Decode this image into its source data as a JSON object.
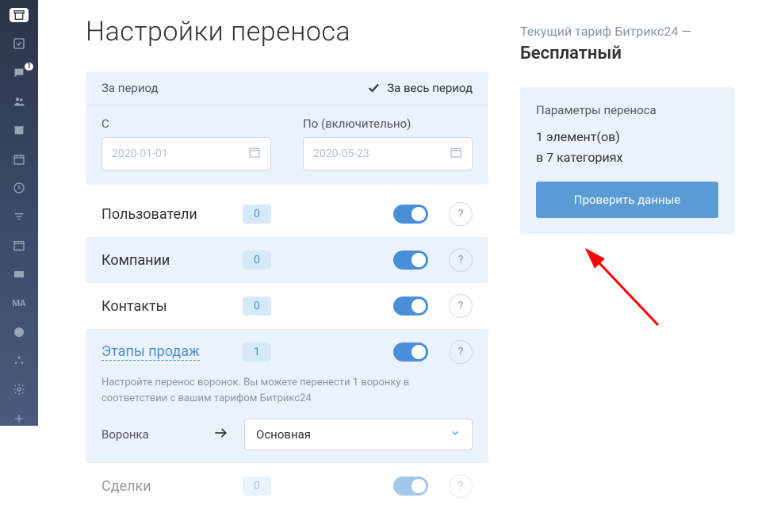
{
  "page_title": "Настройки переноса",
  "period": {
    "header_label": "За период",
    "whole_period_label": "За весь период",
    "from_label": "С",
    "to_label": "По (включительно)",
    "from_value": "2020-01-01",
    "to_value": "2020-05-23"
  },
  "categories": [
    {
      "label": "Пользователи",
      "count": "0",
      "shaded": false
    },
    {
      "label": "Компании",
      "count": "0",
      "shaded": true
    },
    {
      "label": "Контакты",
      "count": "0",
      "shaded": false
    }
  ],
  "stages": {
    "label": "Этапы продаж",
    "count": "1",
    "description": "Настройте перенос воронок. Вы можете перенести 1 воронку в соответствии с вашим тарифом Битрикс24",
    "funnel_label": "Воронка",
    "funnel_value": "Основная"
  },
  "last_cat": {
    "label": "Сделки",
    "count": "0"
  },
  "help": "?",
  "side": {
    "tariff_line": "Текущий тариф Битрикс24 —",
    "tariff_name": "Бесплатный",
    "params_title": "Параметры переноса",
    "elements_line": "1 элемент(ов)",
    "categories_line": "в 7 категориях",
    "check_btn": "Проверить данные"
  },
  "sidebar": {
    "badge": "1",
    "ma": "MA"
  }
}
